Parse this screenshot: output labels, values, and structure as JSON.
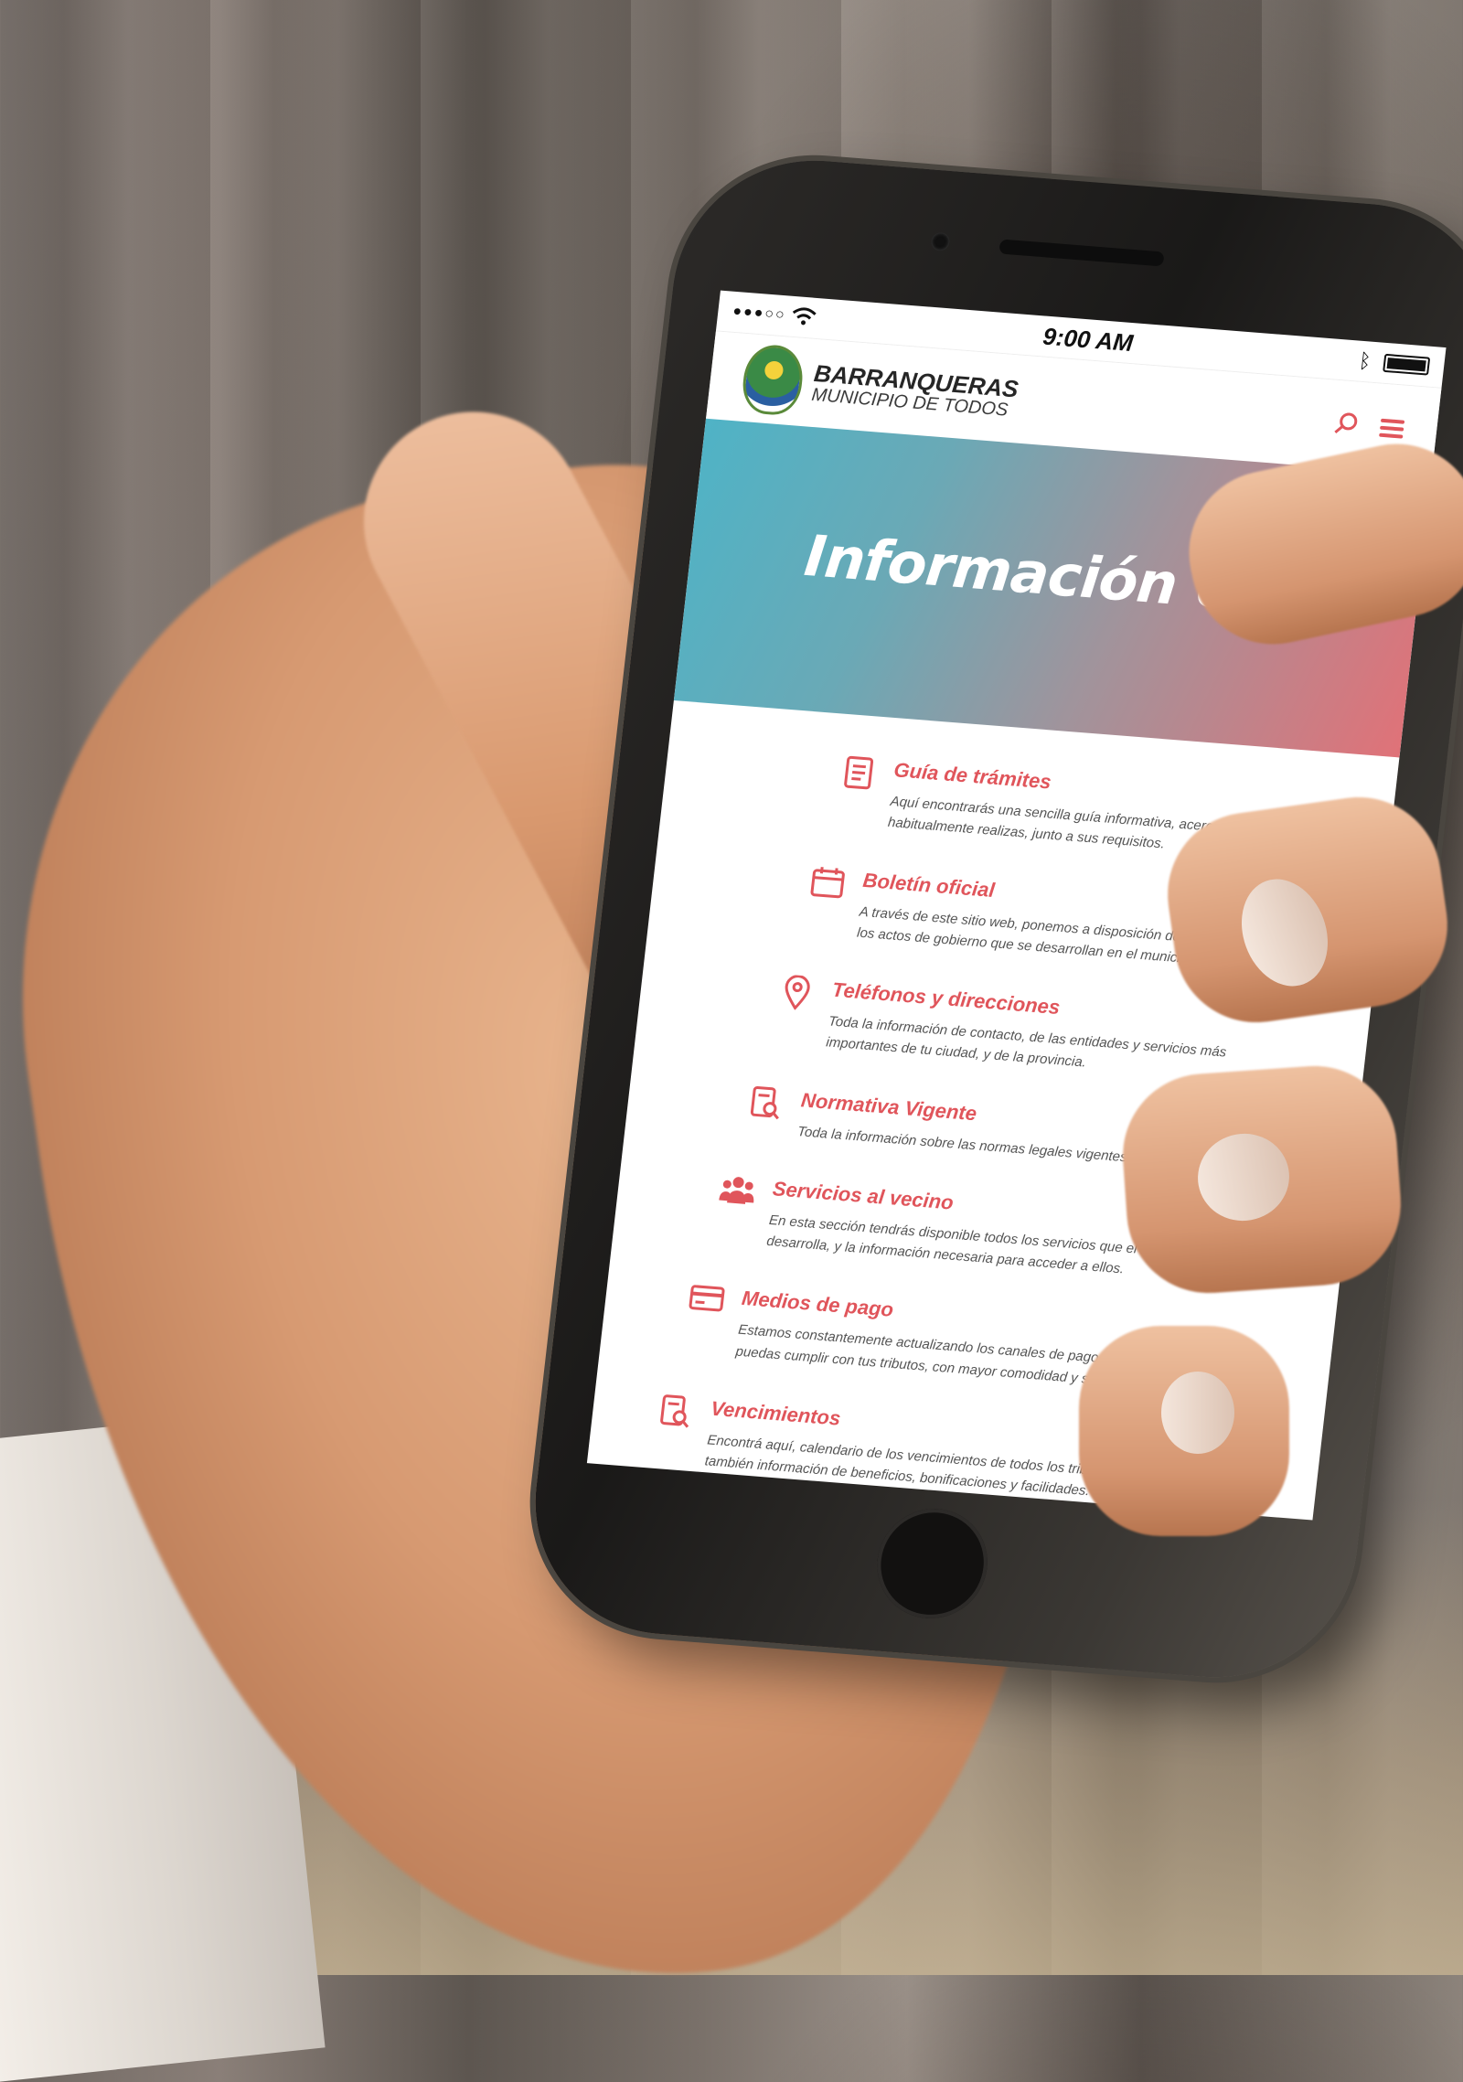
{
  "status_bar": {
    "carrier": "●●●○○",
    "time": "9:00 AM"
  },
  "header": {
    "brand_name": "BARRANQUERAS",
    "brand_subtitle": "MUNICIPIO DE TODOS",
    "search_icon": "search-icon",
    "menu_icon": "hamburger-menu-icon"
  },
  "hero": {
    "title": "Información Útil"
  },
  "items": [
    {
      "icon": "document-list-icon",
      "title": "Guía de trámites",
      "description": "Aquí encontrarás una sencilla guía informativa, acerca de los trámites que habitualmente realizas, junto a sus requisitos."
    },
    {
      "icon": "calendar-icon",
      "title": "Boletín oficial",
      "description": "A través de este sitio web, ponemos a disposición de la comunidad, todos los actos de gobierno que se desarrollan en el municipio."
    },
    {
      "icon": "location-pin-icon",
      "title": "Teléfonos y direcciones",
      "description": "Toda la información de contacto, de las entidades y servicios más importantes de tu ciudad, y de la provincia."
    },
    {
      "icon": "document-search-icon",
      "title": "Normativa Vigente",
      "description": "Toda la información sobre las normas legales vigentes."
    },
    {
      "icon": "people-group-icon",
      "title": "Servicios al vecino",
      "description": "En esta sección tendrás disponible todos los servicios que el municipio desarrolla, y la información necesaria para acceder a ellos."
    },
    {
      "icon": "credit-card-icon",
      "title": "Medios de pago",
      "description": "Estamos constantemente actualizando los canales de pago, para que puedas cumplir con tus tributos, con mayor comodidad y seguridad."
    },
    {
      "icon": "document-search-icon",
      "title": "Vencimientos",
      "description": "Encontrá aquí, calendario de los vencimientos de todos los tributos. Como también información de beneficios, bonificaciones y facilidades."
    }
  ],
  "colors": {
    "accent": "#e0555b",
    "hero_start": "#4fb3c6",
    "hero_end": "#e07278"
  }
}
